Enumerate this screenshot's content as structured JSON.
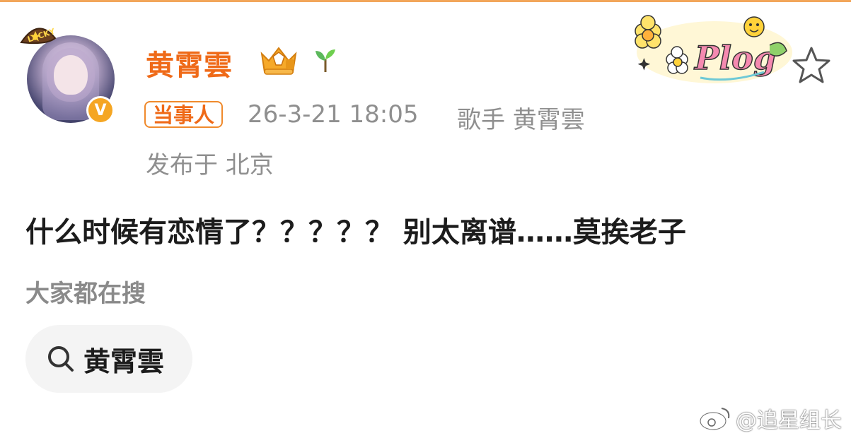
{
  "post": {
    "username": "黄霄雲",
    "avatar_badge": "LUCKY",
    "verified_mark": "V",
    "tag": "当事人",
    "timestamp": "26-3-21 18:05",
    "source": "歌手 黄霄雲",
    "location": "发布于 北京",
    "text": "什么时候有恋情了？？？？？ 别太离谱……莫挨老子"
  },
  "trending": {
    "title": "大家都在搜",
    "chip_label": "黄霄雲"
  },
  "decoration": {
    "sticker_text": "Plog"
  },
  "watermark": {
    "text": "@追星组长"
  },
  "colors": {
    "accent_orange": "#ef6a18",
    "meta_gray": "#8f8f8f",
    "chip_bg": "#f4f4f4"
  },
  "icons": [
    "crown-icon",
    "sprout-icon",
    "star-icon",
    "search-icon",
    "verified-icon",
    "weibo-icon"
  ]
}
